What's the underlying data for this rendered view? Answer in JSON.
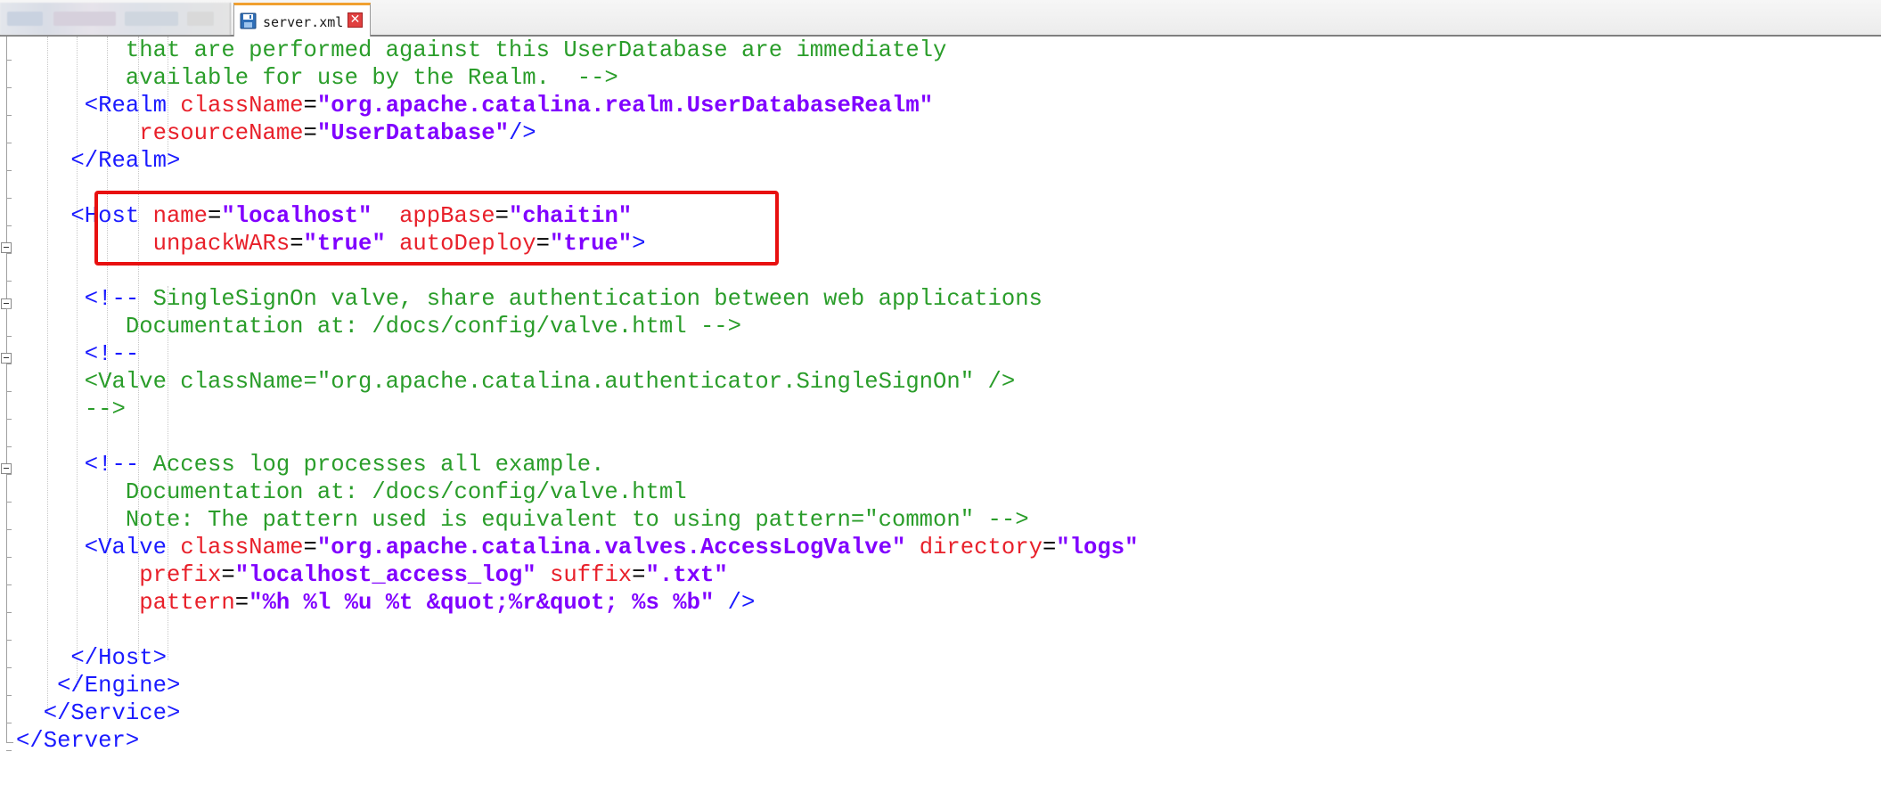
{
  "tabs": {
    "blurred_tab": "",
    "active_tab": {
      "label": "server.xml",
      "close": "✕"
    }
  },
  "editor": {
    "lines": [
      {
        "segs": [
          {
            "c": "cmt",
            "t": "        that are performed against this UserDatabase are immediately"
          }
        ]
      },
      {
        "segs": [
          {
            "c": "cmt",
            "t": "        available for use by the Realm.  -->"
          }
        ]
      },
      {
        "segs": [
          {
            "c": "tag",
            "t": "     <Realm "
          },
          {
            "c": "attr",
            "t": "className"
          },
          {
            "c": "eq",
            "t": "="
          },
          {
            "c": "val",
            "t": "\"org.apache.catalina.realm.UserDatabaseRealm\""
          }
        ]
      },
      {
        "segs": [
          {
            "c": "attr",
            "t": "         resourceName"
          },
          {
            "c": "eq",
            "t": "="
          },
          {
            "c": "val",
            "t": "\"UserDatabase\""
          },
          {
            "c": "tag",
            "t": "/>"
          }
        ]
      },
      {
        "segs": [
          {
            "c": "tag",
            "t": "    </Realm>"
          }
        ]
      },
      {
        "segs": []
      },
      {
        "segs": [
          {
            "c": "tag",
            "t": "    <Host "
          },
          {
            "c": "attr",
            "t": "name"
          },
          {
            "c": "eq",
            "t": "="
          },
          {
            "c": "val",
            "t": "\"localhost\""
          },
          {
            "c": "eq",
            "t": "  "
          },
          {
            "c": "attr",
            "t": "appBase"
          },
          {
            "c": "eq",
            "t": "="
          },
          {
            "c": "val",
            "t": "\"chaitin\""
          }
        ]
      },
      {
        "segs": [
          {
            "c": "attr",
            "t": "          unpackWARs"
          },
          {
            "c": "eq",
            "t": "="
          },
          {
            "c": "val",
            "t": "\"true\""
          },
          {
            "c": "eq",
            "t": " "
          },
          {
            "c": "attr",
            "t": "autoDeploy"
          },
          {
            "c": "eq",
            "t": "="
          },
          {
            "c": "val",
            "t": "\"true\""
          },
          {
            "c": "tag",
            "t": ">"
          }
        ]
      },
      {
        "segs": []
      },
      {
        "segs": [
          {
            "c": "tag",
            "t": "     <!-- "
          },
          {
            "c": "cmt",
            "t": "SingleSignOn valve, share authentication between web applications"
          }
        ]
      },
      {
        "segs": [
          {
            "c": "cmt",
            "t": "        Documentation at: /docs/config/valve.html -->"
          }
        ]
      },
      {
        "segs": [
          {
            "c": "tag",
            "t": "     <!--"
          }
        ]
      },
      {
        "segs": [
          {
            "c": "cmt",
            "t": "     <Valve className=\"org.apache.catalina.authenticator.SingleSignOn\" />"
          }
        ]
      },
      {
        "segs": [
          {
            "c": "cmt",
            "t": "     -->"
          }
        ]
      },
      {
        "segs": []
      },
      {
        "segs": [
          {
            "c": "tag",
            "t": "     <!-- "
          },
          {
            "c": "cmt",
            "t": "Access log processes all example."
          }
        ]
      },
      {
        "segs": [
          {
            "c": "cmt",
            "t": "        Documentation at: /docs/config/valve.html"
          }
        ]
      },
      {
        "segs": [
          {
            "c": "cmt",
            "t": "        Note: The pattern used is equivalent to using pattern=\"common\" -->"
          }
        ]
      },
      {
        "segs": [
          {
            "c": "tag",
            "t": "     <Valve "
          },
          {
            "c": "attr",
            "t": "className"
          },
          {
            "c": "eq",
            "t": "="
          },
          {
            "c": "val",
            "t": "\"org.apache.catalina.valves.AccessLogValve\""
          },
          {
            "c": "eq",
            "t": " "
          },
          {
            "c": "attr",
            "t": "directory"
          },
          {
            "c": "eq",
            "t": "="
          },
          {
            "c": "val",
            "t": "\"logs\""
          }
        ]
      },
      {
        "segs": [
          {
            "c": "attr",
            "t": "         prefix"
          },
          {
            "c": "eq",
            "t": "="
          },
          {
            "c": "val",
            "t": "\"localhost_access_log\""
          },
          {
            "c": "eq",
            "t": " "
          },
          {
            "c": "attr",
            "t": "suffix"
          },
          {
            "c": "eq",
            "t": "="
          },
          {
            "c": "val",
            "t": "\".txt\""
          }
        ]
      },
      {
        "segs": [
          {
            "c": "attr",
            "t": "         pattern"
          },
          {
            "c": "eq",
            "t": "="
          },
          {
            "c": "val",
            "t": "\"%h %l %u %t &quot;%r&quot; %s %b\""
          },
          {
            "c": "eq",
            "t": " "
          },
          {
            "c": "tag",
            "t": "/>"
          }
        ]
      },
      {
        "segs": []
      },
      {
        "segs": [
          {
            "c": "tag",
            "t": "    </Host>"
          }
        ]
      },
      {
        "segs": [
          {
            "c": "tag",
            "t": "   </Engine>"
          }
        ]
      },
      {
        "segs": [
          {
            "c": "tag",
            "t": "  </Service>"
          }
        ]
      },
      {
        "segs": [
          {
            "c": "tag",
            "t": "</Server>"
          }
        ]
      }
    ]
  },
  "colors": {
    "tag": "#1a1aff",
    "attribute": "#e8202a",
    "value": "#8000ff",
    "comment": "#2a9d2a",
    "highlight_border": "#e81010",
    "active_tab_accent": "#f0a030"
  }
}
